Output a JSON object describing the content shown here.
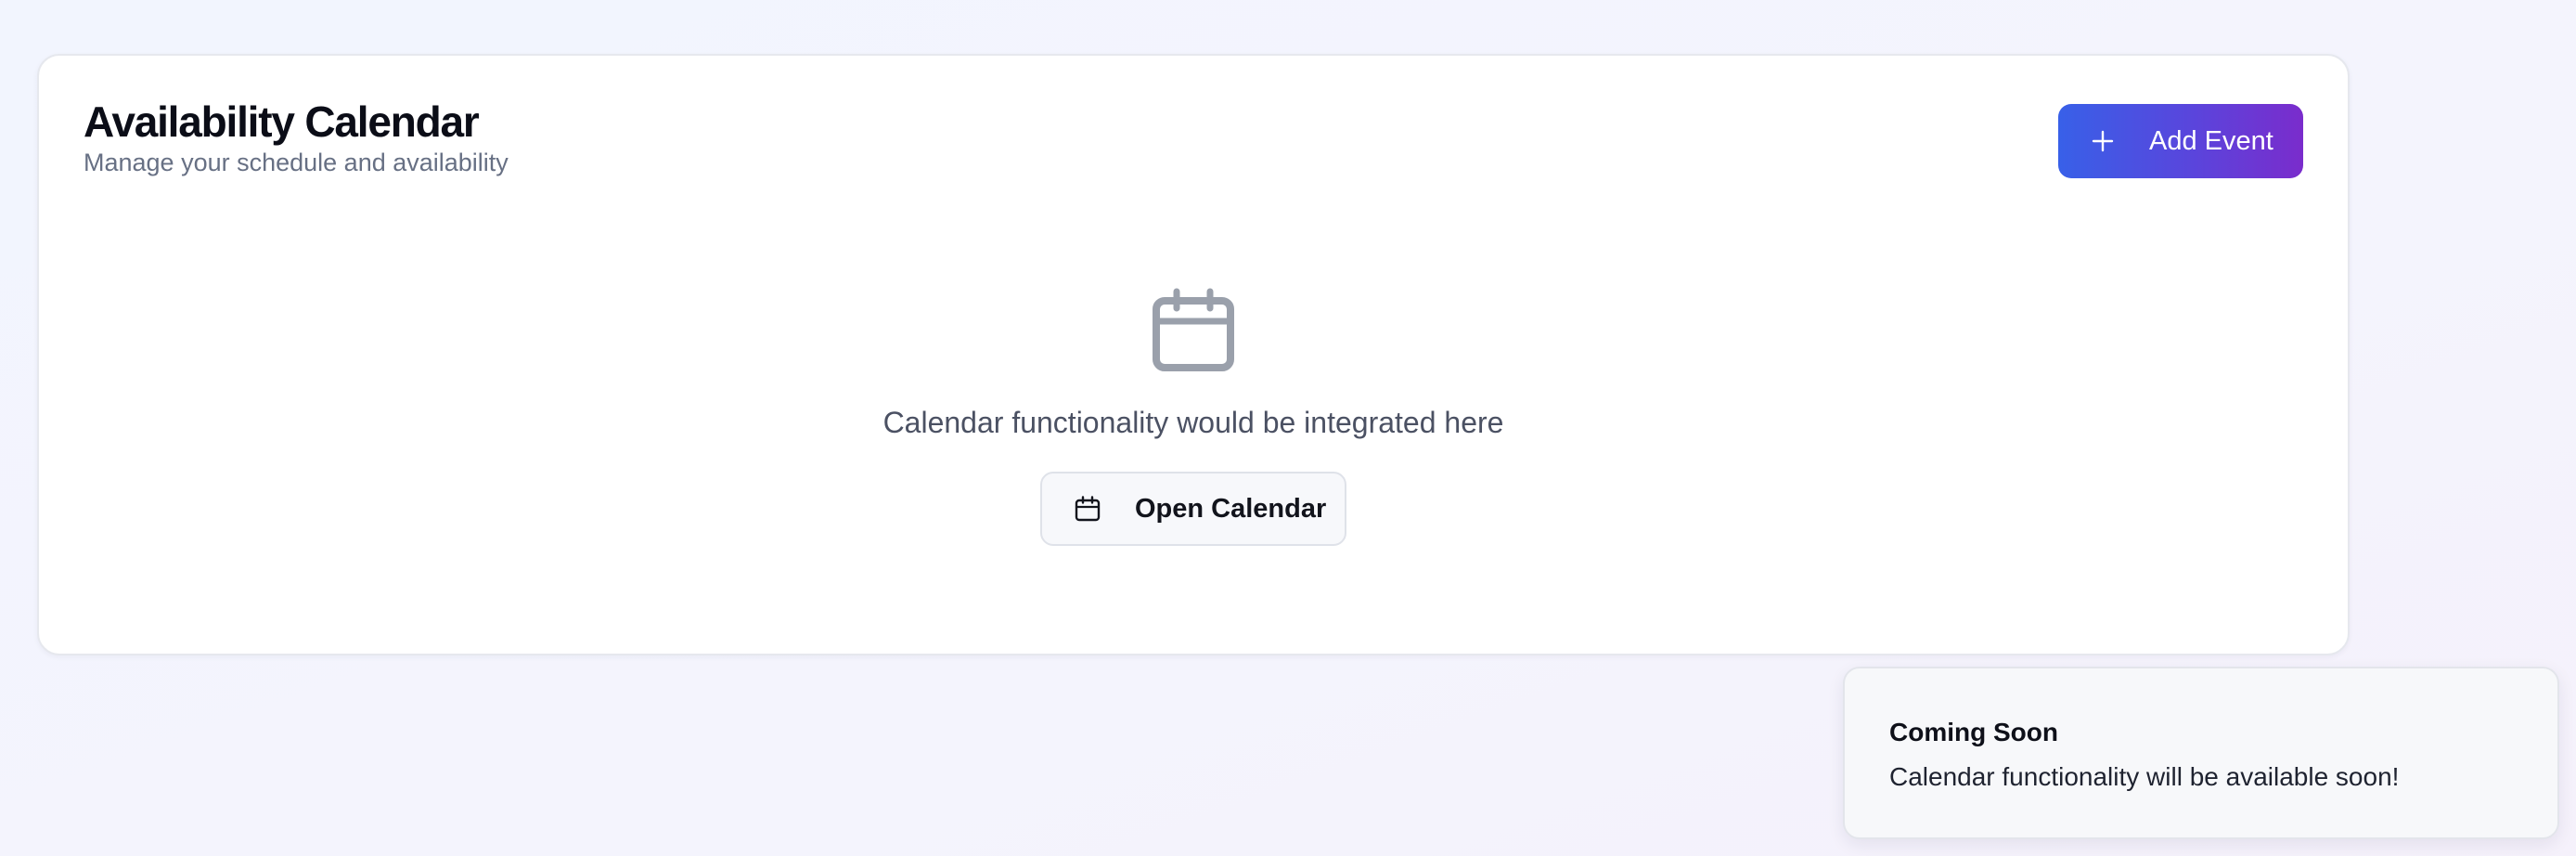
{
  "header": {
    "title": "Availability Calendar",
    "subtitle": "Manage your schedule and availability",
    "add_event_label": "Add Event",
    "add_event_icon": "plus-icon"
  },
  "empty_state": {
    "icon": "calendar-icon",
    "message": "Calendar functionality would be integrated here",
    "open_calendar_label": "Open Calendar",
    "open_calendar_icon": "calendar-icon"
  },
  "toast": {
    "title": "Coming Soon",
    "message": "Calendar functionality will be available soon!"
  },
  "colors": {
    "accent_gradient_start": "#3860e8",
    "accent_gradient_end": "#7a2ccc",
    "icon_gray": "#9aa0ab",
    "title_text": "#0b0d17",
    "muted_text": "#677084"
  }
}
